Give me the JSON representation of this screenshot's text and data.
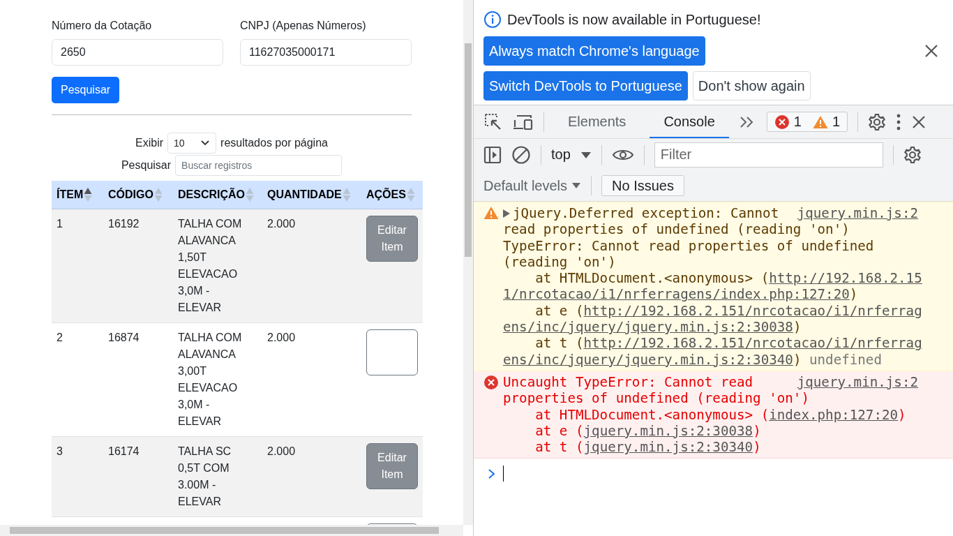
{
  "page": {
    "fields": [
      {
        "label": "Número da Cotação",
        "value": "2650"
      },
      {
        "label": "CNPJ (Apenas Números)",
        "value": "11627035000171"
      }
    ],
    "search_button": "Pesquisar",
    "length_menu": {
      "before": "Exibir",
      "value": "10",
      "after": "resultados por página"
    },
    "filter": {
      "label": "Pesquisar",
      "placeholder": "Buscar registros"
    },
    "table": {
      "columns": [
        {
          "label": "ÍTEM",
          "sorted": true
        },
        {
          "label": "CÓDIGO",
          "sorted": false
        },
        {
          "label": "DESCRIÇÃO",
          "sorted": false
        },
        {
          "label": "QUANTIDADE",
          "sorted": false
        },
        {
          "label": "AÇÕES",
          "sorted": false
        }
      ],
      "rows": [
        {
          "cells": [
            "1",
            "16192",
            "TALHA COM ALAVANCA 1,50T ELEVACAO 3,0M - ELEVAR",
            "2.000"
          ],
          "action": {
            "label": "Editar Item",
            "disabled": true
          }
        },
        {
          "cells": [
            "2",
            "16874",
            "TALHA COM ALAVANCA 3,00T ELEVACAO 3,0M - ELEVAR",
            "2.000"
          ],
          "action": {
            "disabled": false
          }
        },
        {
          "cells": [
            "3",
            "16174",
            "TALHA SC 0,5T COM 3.00M - ELEVAR",
            "2.000"
          ],
          "action": {
            "label": "Editar Item",
            "disabled": true
          }
        },
        {
          "action": {
            "disabled": false
          }
        }
      ]
    }
  },
  "devtools": {
    "infobar": {
      "message": "DevTools is now available in Portuguese!",
      "buttons": [
        {
          "label": "Always match Chrome's language",
          "primary": true
        },
        {
          "label": "Switch DevTools to Portuguese",
          "primary": true
        },
        {
          "label": "Don't show again",
          "primary": false
        }
      ]
    },
    "tabs": [
      {
        "label": "Elements",
        "selected": false
      },
      {
        "label": "Console",
        "selected": true
      }
    ],
    "counts": {
      "errors": "1",
      "warnings": "1"
    },
    "context": "top",
    "filter_placeholder": "Filter",
    "levels": "Default levels",
    "issues": "No Issues",
    "messages": [
      {
        "kind": "warning",
        "expandable": true,
        "source": "jquery.min.js:2",
        "lines": [
          [
            {
              "text": "jQuery.Deferred exception: Cannot"
            }
          ],
          [
            {
              "text": "read properties of undefined (reading 'on')"
            }
          ],
          [
            {
              "text": "TypeError: Cannot read properties of undefined"
            }
          ],
          [
            {
              "text": "(reading 'on')"
            }
          ],
          [
            {
              "text": "    at HTMLDocument.<anonymous> ("
            },
            {
              "text": "http://192.168.2.15",
              "kind": "link"
            }
          ],
          [
            {
              "text": "1/nrcotacao/i1/nrferragens/index.php:127:20",
              "kind": "link"
            },
            {
              "text": ")"
            }
          ],
          [
            {
              "text": "    at e ("
            },
            {
              "text": "http://192.168.2.151/nrcotacao/i1/nrferrag",
              "kind": "link"
            }
          ],
          [
            {
              "text": "ens/inc/jquery/jquery.min.js:2:30038",
              "kind": "link"
            },
            {
              "text": ")"
            }
          ],
          [
            {
              "text": "    at t ("
            },
            {
              "text": "http://192.168.2.151/nrcotacao/i1/nrferrag",
              "kind": "link"
            }
          ],
          [
            {
              "text": "ens/inc/jquery/jquery.min.js:2:30340",
              "kind": "link"
            },
            {
              "text": ") "
            },
            {
              "text": "undefined",
              "kind": "dim"
            }
          ]
        ]
      },
      {
        "kind": "error",
        "expandable": false,
        "source": "jquery.min.js:2",
        "lines": [
          [
            {
              "text": "Uncaught TypeError: Cannot read"
            }
          ],
          [
            {
              "text": "properties of undefined (reading 'on')"
            }
          ],
          [
            {
              "text": "    at HTMLDocument.<anonymous> ("
            },
            {
              "text": "index.php:127:20",
              "kind": "link"
            },
            {
              "text": ")"
            }
          ],
          [
            {
              "text": "    at e ("
            },
            {
              "text": "jquery.min.js:2:30038",
              "kind": "link"
            },
            {
              "text": ")"
            }
          ],
          [
            {
              "text": "    at t ("
            },
            {
              "text": "jquery.min.js:2:30340",
              "kind": "link"
            },
            {
              "text": ")"
            }
          ]
        ]
      }
    ]
  }
}
